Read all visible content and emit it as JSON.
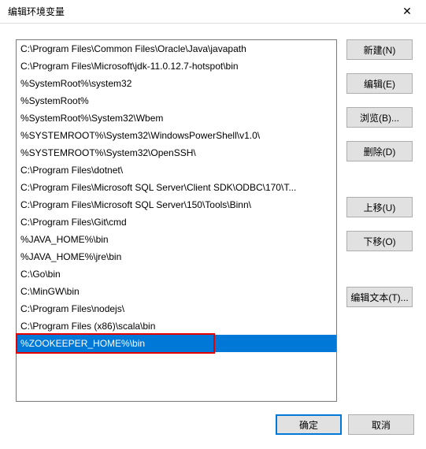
{
  "title": "编辑环境变量",
  "list": {
    "items": [
      "C:\\Program Files\\Common Files\\Oracle\\Java\\javapath",
      "C:\\Program Files\\Microsoft\\jdk-11.0.12.7-hotspot\\bin",
      "%SystemRoot%\\system32",
      "%SystemRoot%",
      "%SystemRoot%\\System32\\Wbem",
      "%SYSTEMROOT%\\System32\\WindowsPowerShell\\v1.0\\",
      "%SYSTEMROOT%\\System32\\OpenSSH\\",
      "C:\\Program Files\\dotnet\\",
      "C:\\Program Files\\Microsoft SQL Server\\Client SDK\\ODBC\\170\\T...",
      "C:\\Program Files\\Microsoft SQL Server\\150\\Tools\\Binn\\",
      "C:\\Program Files\\Git\\cmd",
      "%JAVA_HOME%\\bin",
      "%JAVA_HOME%\\jre\\bin",
      "C:\\Go\\bin",
      "C:\\MinGW\\bin",
      "C:\\Program Files\\nodejs\\",
      "C:\\Program Files (x86)\\scala\\bin",
      "%ZOOKEEPER_HOME%\\bin"
    ],
    "selected_index": 17
  },
  "buttons": {
    "new": "新建(N)",
    "edit": "编辑(E)",
    "browse": "浏览(B)...",
    "delete": "删除(D)",
    "move_up": "上移(U)",
    "move_down": "下移(O)",
    "edit_text": "编辑文本(T)...",
    "ok": "确定",
    "cancel": "取消"
  }
}
